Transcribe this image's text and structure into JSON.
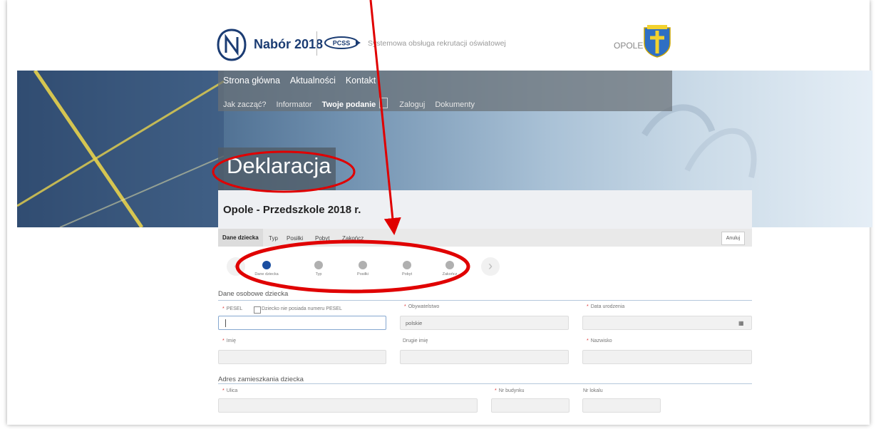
{
  "header": {
    "brand": "Nabór 2018",
    "pcss": "PCSS",
    "tagline": "Systemowa obsługa rekrutacji oświatowej",
    "city": "OPOLE"
  },
  "nav": {
    "row1": [
      "Strona główna",
      "Aktualności",
      "Kontakt"
    ],
    "row2": [
      "Jak zacząć?",
      "Informator",
      "Twoje podanie",
      "Zaloguj",
      "Dokumenty"
    ],
    "active": "Twoje podanie"
  },
  "page_title": "Deklaracja",
  "panel_title": "Opole - Przedszkole 2018 r.",
  "tabs": [
    "Dane dziecka",
    "Typ",
    "Posiłki",
    "Pobyt",
    "Zakończ"
  ],
  "cancel_label": "Anuluj",
  "steps": [
    "Dane dziecka",
    "Typ",
    "Posiłki",
    "Pobyt",
    "Zakończ"
  ],
  "active_step": 0,
  "arrows": {
    "prev": "‹",
    "next": "›"
  },
  "personal": {
    "section": "Dane osobowe dziecka",
    "pesel_label": "PESEL",
    "no_pesel_label": "Dziecko nie posiada numeru PESEL",
    "citizenship_label": "Obywatelstwo",
    "citizenship_value": "polskie",
    "dob_label": "Data urodzenia",
    "first_name_label": "Imię",
    "second_name_label": "Drugie imię",
    "last_name_label": "Nazwisko",
    "calendar_icon": "calendar-icon"
  },
  "address": {
    "section": "Adres zamieszkania dziecka",
    "street_label": "Ulica",
    "building_label": "Nr budynku",
    "apartment_label": "Nr lokalu"
  },
  "colors": {
    "brand": "#1b3c73",
    "step_active": "#1a4ea0",
    "annotation": "#e00000",
    "required": "#dd3333"
  }
}
